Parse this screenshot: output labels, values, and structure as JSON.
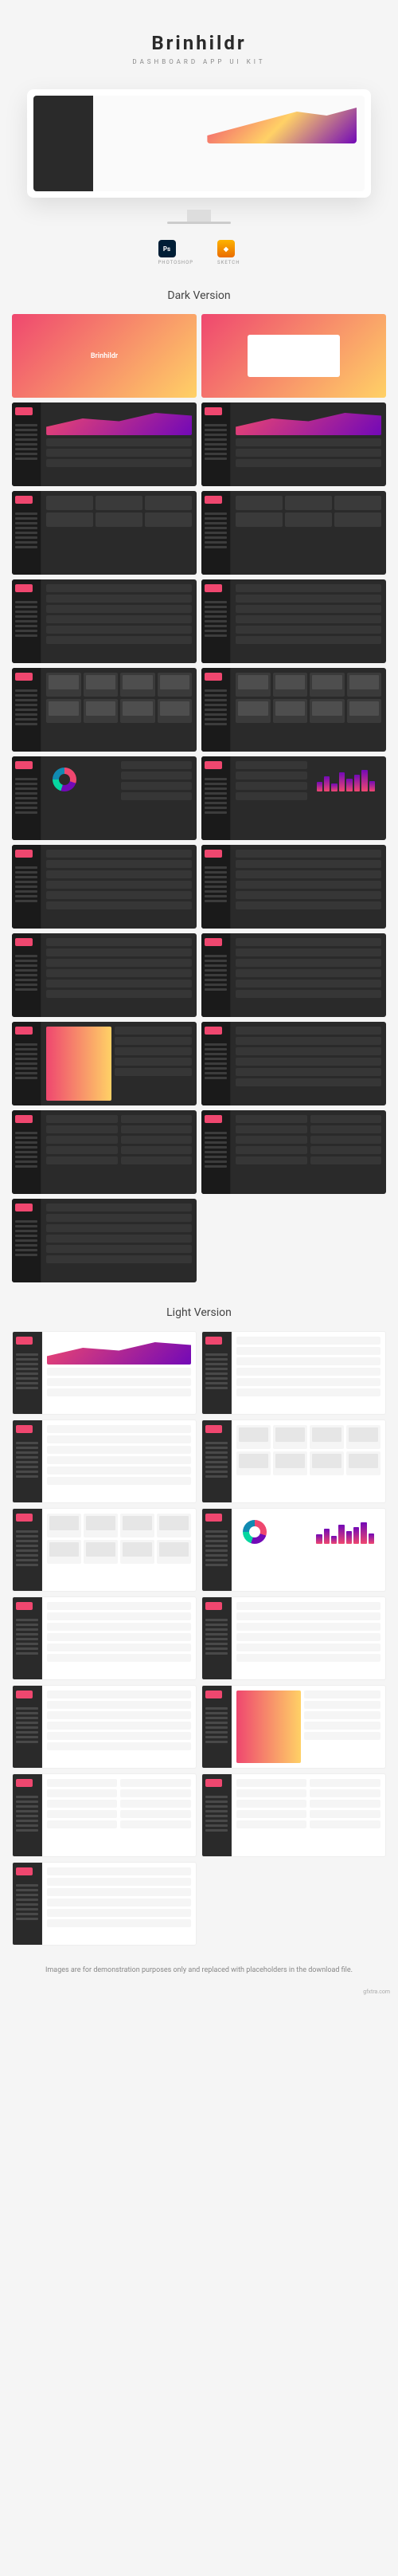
{
  "product": {
    "name": "Brinhildr",
    "tagline": "DASHBOARD APP UI KIT"
  },
  "tools": {
    "photoshop": "PHOTOSHOP",
    "sketch": "SKETCH"
  },
  "sections": {
    "dark_title": "Dark Version",
    "light_title": "Light Version"
  },
  "footer_note": "Images are for demonstration purposes only and replaced with placeholders in the download file.",
  "watermark": "gfxtra.com",
  "thumbs": {
    "dark": [
      {
        "type": "splash-logo"
      },
      {
        "type": "splash-box"
      },
      {
        "type": "chart"
      },
      {
        "type": "chart"
      },
      {
        "type": "cards"
      },
      {
        "type": "cards"
      },
      {
        "type": "rows"
      },
      {
        "type": "rows"
      },
      {
        "type": "products"
      },
      {
        "type": "products"
      },
      {
        "type": "donut"
      },
      {
        "type": "bars"
      },
      {
        "type": "rows"
      },
      {
        "type": "rows"
      },
      {
        "type": "rows"
      },
      {
        "type": "rows"
      },
      {
        "type": "accent"
      },
      {
        "type": "rows"
      },
      {
        "type": "split"
      },
      {
        "type": "split"
      },
      {
        "type": "rows"
      }
    ],
    "light": [
      {
        "type": "chart"
      },
      {
        "type": "rows"
      },
      {
        "type": "rows"
      },
      {
        "type": "products"
      },
      {
        "type": "products"
      },
      {
        "type": "donut-bars"
      },
      {
        "type": "rows"
      },
      {
        "type": "rows"
      },
      {
        "type": "rows"
      },
      {
        "type": "accent"
      },
      {
        "type": "split"
      },
      {
        "type": "split"
      },
      {
        "type": "rows"
      }
    ]
  },
  "bar_heights": [
    40,
    65,
    35,
    80,
    55,
    70,
    90,
    45
  ]
}
